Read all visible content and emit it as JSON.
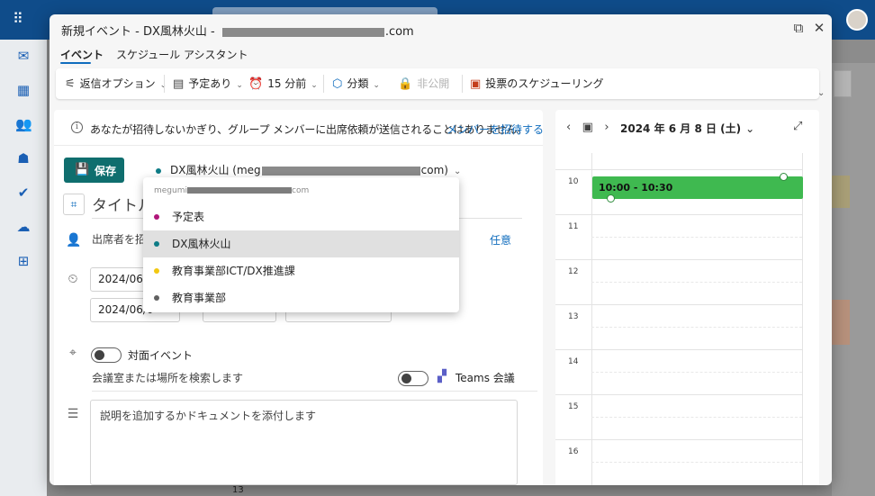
{
  "colors": {
    "accent": "#0f6cbd",
    "save_button": "#0f6e6e",
    "event_green": "#3fb950",
    "cal_dot_schedule": "#b0167a",
    "cal_dot_dx": "#0e7c86",
    "cal_dot_ict": "#f2c811",
    "cal_dot_dept": "#616161"
  },
  "background": {
    "bottom_number": "13"
  },
  "dialog": {
    "title_prefix": "新規イベント - DX風林火山 - ",
    "title_suffix": ".com",
    "tabs": [
      {
        "label": "イベント",
        "active": true
      },
      {
        "label": "スケジュール アシスタント",
        "active": false
      }
    ],
    "toolbar": {
      "reply_options": "返信オプション",
      "show_as": "予定あり",
      "reminder": "15 分前",
      "categorize": "分類",
      "private": "非公開",
      "poll": "投票のスケジューリング"
    }
  },
  "form": {
    "info_text": "あなたが招待しないかぎり、グループ メンバーに出席依頼が送信されることはありません。",
    "info_link": "メンバーを招待する",
    "save_label": "保存",
    "calendar_name": "DX風林火山 (meg",
    "calendar_email_suffix": "com)",
    "title_placeholder": "タイトル",
    "attendees_placeholder": "出席者を招",
    "optional_link": "任意",
    "start_date": "2024/06/0",
    "end_date": "2024/06/0",
    "in_person_label": "対面イベント",
    "room_search_placeholder": "会議室または場所を検索します",
    "teams_label": "Teams 会議",
    "description_placeholder": "説明を追加するかドキュメントを添付します"
  },
  "dropdown": {
    "header_prefix": "megumi",
    "header_suffix": "com",
    "items": [
      {
        "label": "予定表",
        "selected": false
      },
      {
        "label": "DX風林火山",
        "selected": true
      },
      {
        "label": "教育事業部ICT/DX推進課",
        "selected": false
      },
      {
        "label": "教育事業部",
        "selected": false
      }
    ]
  },
  "calendar": {
    "date_label": "2024 年 6 月 8 日 (土)",
    "hours": [
      "10",
      "11",
      "12",
      "13",
      "14",
      "15",
      "16"
    ],
    "event_time": "10:00 - 10:30"
  },
  "icons": {
    "waffle": "grid-icon",
    "info": "info-icon",
    "save": "floppy-icon",
    "popout": "popout-icon",
    "close": "close-icon"
  }
}
